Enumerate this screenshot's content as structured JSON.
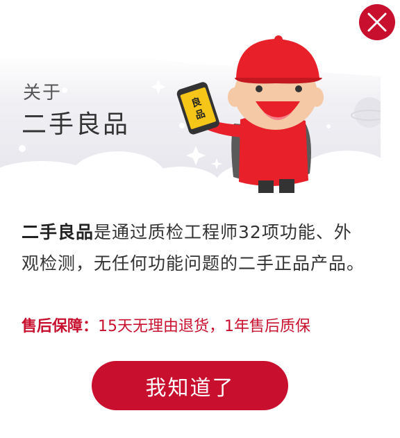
{
  "header": {
    "subtitle": "关于",
    "title": "二手良品",
    "phone_badge_text": "良品"
  },
  "body": {
    "description_lead": "二手良品",
    "description_rest": "是通过质检工程师32项功能、外观检测，无任何功能问题的二手正品产品。",
    "warranty_label": "售后保障：",
    "warranty_text": "15天无理由退货，1年售后质保"
  },
  "actions": {
    "confirm_label": "我知道了"
  },
  "colors": {
    "accent": "#c8102e",
    "phone_yellow": "#f5c518"
  },
  "icons": {
    "close": "close-icon",
    "mascot": "mascot-illustration"
  }
}
